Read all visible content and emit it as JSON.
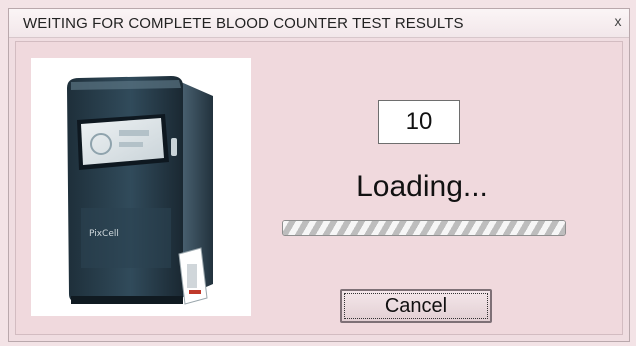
{
  "window": {
    "title": "WEITING FOR COMPLETE BLOOD COUNTER TEST RESULTS",
    "close_glyph": "x"
  },
  "device_image": {
    "brand_text": "PixCell",
    "icon": "blood-analyzer-device-image"
  },
  "counter": {
    "value": "10"
  },
  "status": {
    "text": "Loading..."
  },
  "progress": {
    "mode": "indeterminate",
    "fraction": 1.0
  },
  "buttons": {
    "cancel_label": "Cancel"
  },
  "colors": {
    "window_bg": "#f0dde1",
    "client_bg": "#f0d9dd",
    "titlebar_bg": "#f8eff1",
    "device_body": "#2b4150",
    "device_screen": "#dfe6ea"
  }
}
